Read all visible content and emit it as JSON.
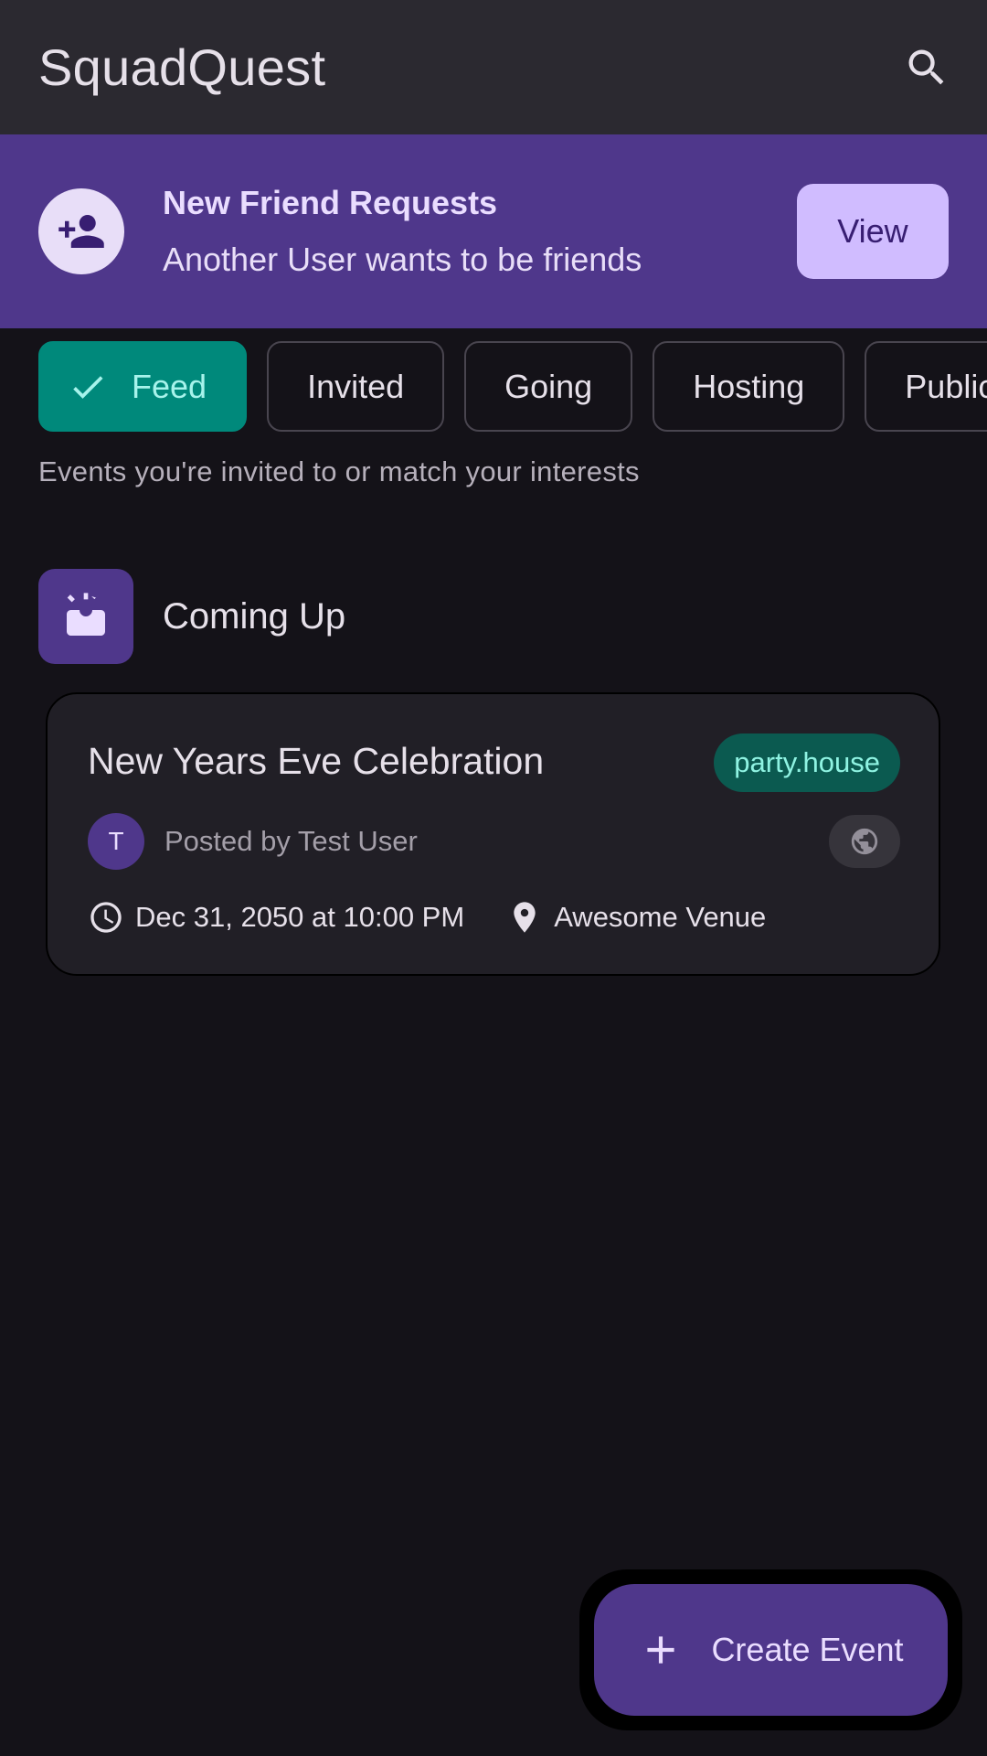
{
  "app": {
    "title": "SquadQuest"
  },
  "appbar": {
    "search_icon": "search-icon"
  },
  "banner": {
    "icon": "person-add-icon",
    "title": "New Friend Requests",
    "subtitle": "Another User wants to be friends",
    "action_label": "View"
  },
  "filters": {
    "chips": [
      {
        "label": "Feed",
        "selected": true
      },
      {
        "label": "Invited",
        "selected": false
      },
      {
        "label": "Going",
        "selected": false
      },
      {
        "label": "Hosting",
        "selected": false
      },
      {
        "label": "Public",
        "selected": false
      }
    ],
    "hint": "Events you're invited to or match your interests"
  },
  "section": {
    "icon": "upcoming-icon",
    "title": "Coming Up"
  },
  "event": {
    "title": "New Years Eve Celebration",
    "tag": "party.house",
    "poster_initial": "T",
    "posted_by": "Posted by Test User",
    "visibility_icon": "public-globe-icon",
    "datetime": "Dec 31, 2050 at 10:00 PM",
    "venue": "Awesome Venue"
  },
  "fab": {
    "label": "Create Event"
  },
  "colors": {
    "background": "#141218",
    "appbar": "#2b2930",
    "primary_container": "#4f378b",
    "primary": "#d0bcff",
    "chip_selected": "#00897b",
    "tag_bg": "#0b5a50"
  }
}
